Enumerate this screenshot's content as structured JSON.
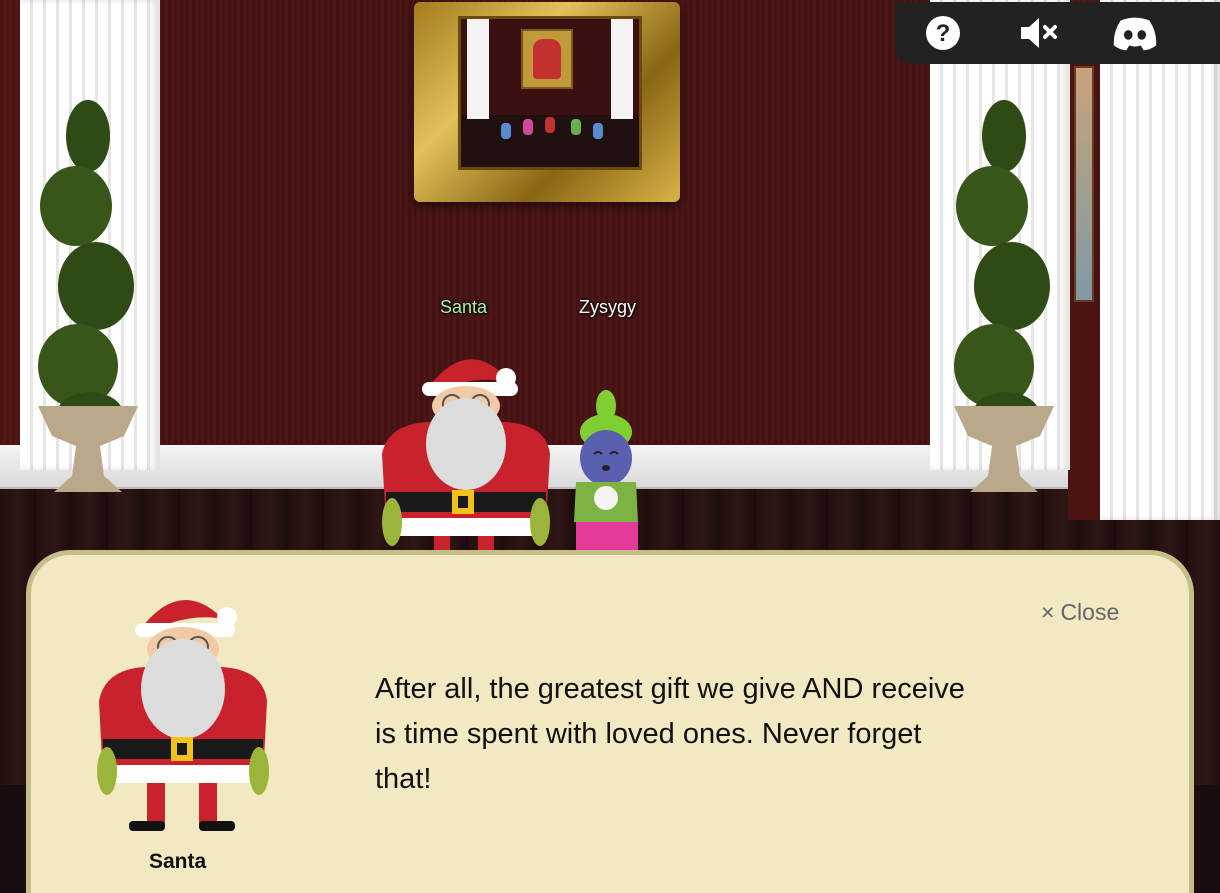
{
  "hud": {
    "help_icon": "question-circle-icon",
    "mute_icon": "speaker-muted-icon",
    "discord_icon": "discord-icon"
  },
  "characters": {
    "santa_name": "Santa",
    "player_name": "Zysygy"
  },
  "dialog": {
    "close_label": "Close",
    "close_icon": "×",
    "speaker": "Santa",
    "text": "After all, the greatest gift we give AND receive is time spent with loved ones. Never forget that!"
  },
  "colors": {
    "dialog_bg": "#f2e8c2",
    "dialog_border": "#c7bd88",
    "wall": "#4a1414",
    "santa_tag": "#a8f0a0",
    "hud_bg": "#222222"
  }
}
